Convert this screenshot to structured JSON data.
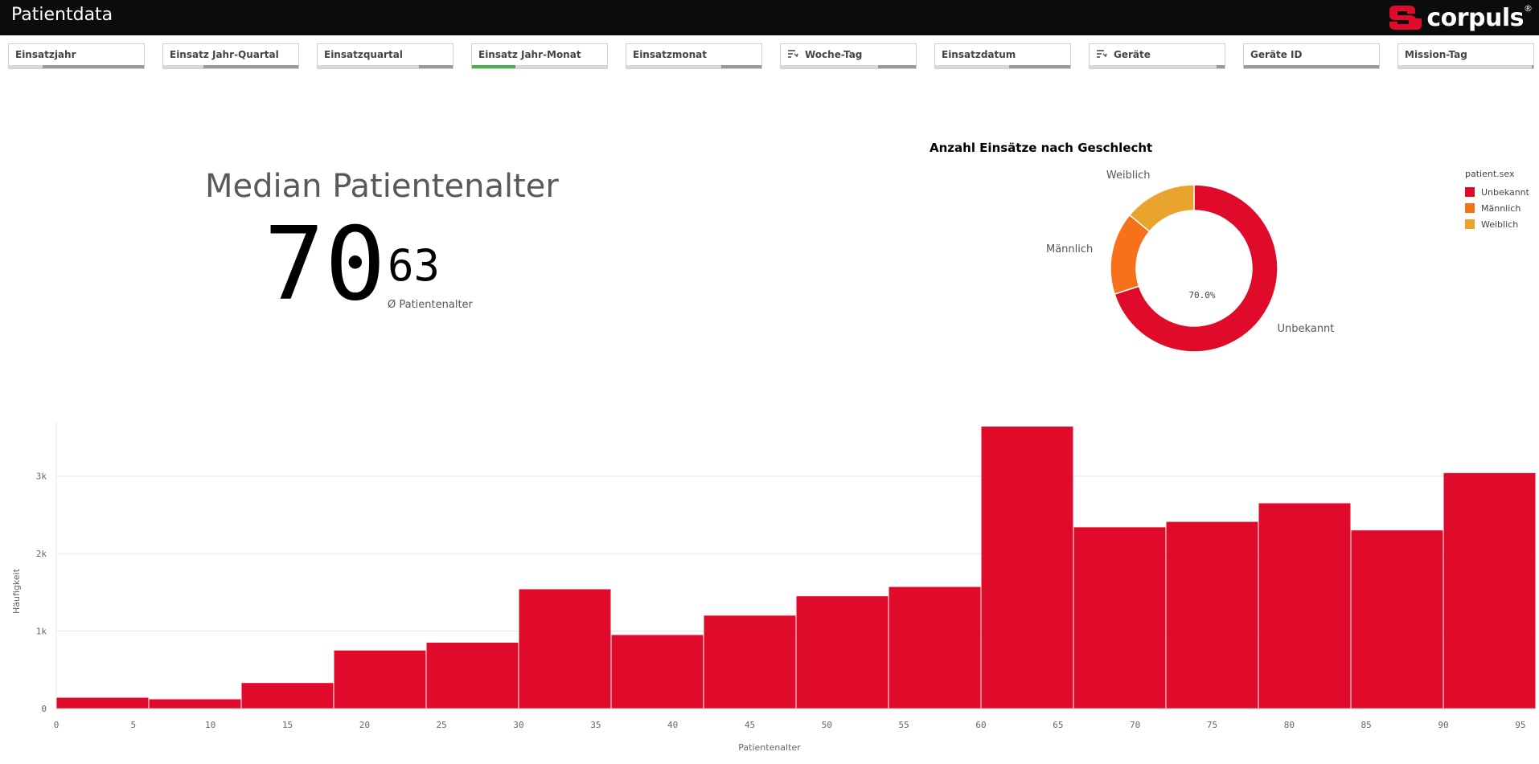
{
  "header": {
    "title": "Patientdata",
    "logo_text": "corpuls",
    "logo_reg": "®"
  },
  "filters": [
    {
      "label": "Einsatzjahr",
      "icon": "",
      "fill_start": 0.25,
      "fill_end": 1.0,
      "fill_color": "#9a9a9a"
    },
    {
      "label": "Einsatz Jahr-Quartal",
      "icon": "",
      "fill_start": 0.3,
      "fill_end": 1.0,
      "fill_color": "#9a9a9a"
    },
    {
      "label": "Einsatzquartal",
      "icon": "",
      "fill_start": 0.75,
      "fill_end": 1.0,
      "fill_color": "#9a9a9a"
    },
    {
      "label": "Einsatz Jahr-Monat",
      "icon": "",
      "fill_start": 0.0,
      "fill_end": 0.32,
      "fill_color": "#4caf50"
    },
    {
      "label": "Einsatzmonat",
      "icon": "",
      "fill_start": 0.7,
      "fill_end": 1.0,
      "fill_color": "#9a9a9a"
    },
    {
      "label": "Woche-Tag",
      "icon": "filter-list-icon",
      "fill_start": 0.72,
      "fill_end": 1.0,
      "fill_color": "#9a9a9a"
    },
    {
      "label": "Einsatzdatum",
      "icon": "",
      "fill_start": 0.55,
      "fill_end": 1.0,
      "fill_color": "#9a9a9a"
    },
    {
      "label": "Geräte",
      "icon": "filter-list-icon",
      "fill_start": 0.94,
      "fill_end": 1.0,
      "fill_color": "#9a9a9a"
    },
    {
      "label": "Geräte ID",
      "icon": "",
      "fill_start": 0.0,
      "fill_end": 1.0,
      "fill_color": "#9a9a9a"
    },
    {
      "label": "Mission-Tag",
      "icon": "",
      "fill_start": 0.99,
      "fill_end": 1.0,
      "fill_color": "#9a9a9a"
    }
  ],
  "kpi": {
    "title": "Median Patientenalter",
    "main_value": "70",
    "sub_value": "63",
    "sub_label": "Ø Patientenalter"
  },
  "donut": {
    "center_label": "70.0%"
  },
  "chart_data": [
    {
      "type": "pie",
      "title": "Anzahl Einsätze nach Geschlecht",
      "legend_title": "patient.sex",
      "legend_position": "right",
      "donut": true,
      "slices": [
        {
          "name": "Unbekannt",
          "value": 70.0,
          "color": "#e00b2b"
        },
        {
          "name": "Männlich",
          "value": 16.0,
          "color": "#f7711b"
        },
        {
          "name": "Weiblich",
          "value": 14.0,
          "color": "#e8a42c"
        }
      ]
    },
    {
      "type": "bar",
      "title": "",
      "xlabel": "Patientenalter",
      "ylabel": "Häufigkeit",
      "bin_width": 6,
      "x_start": 0,
      "xlim": [
        0,
        96
      ],
      "ylim": [
        0,
        3650
      ],
      "x_ticks": [
        0,
        5,
        10,
        15,
        20,
        25,
        30,
        35,
        40,
        45,
        50,
        55,
        60,
        65,
        70,
        75,
        80,
        85,
        90,
        95
      ],
      "y_ticks": [
        0,
        1000,
        2000,
        3000
      ],
      "y_tick_labels": [
        "0",
        "1k",
        "2k",
        "3k"
      ],
      "grid": true,
      "bar_color": "#e00b2b",
      "values": [
        140,
        120,
        330,
        750,
        850,
        1540,
        950,
        1200,
        1450,
        1570,
        3640,
        2340,
        2410,
        2650,
        2300,
        3040
      ]
    }
  ]
}
